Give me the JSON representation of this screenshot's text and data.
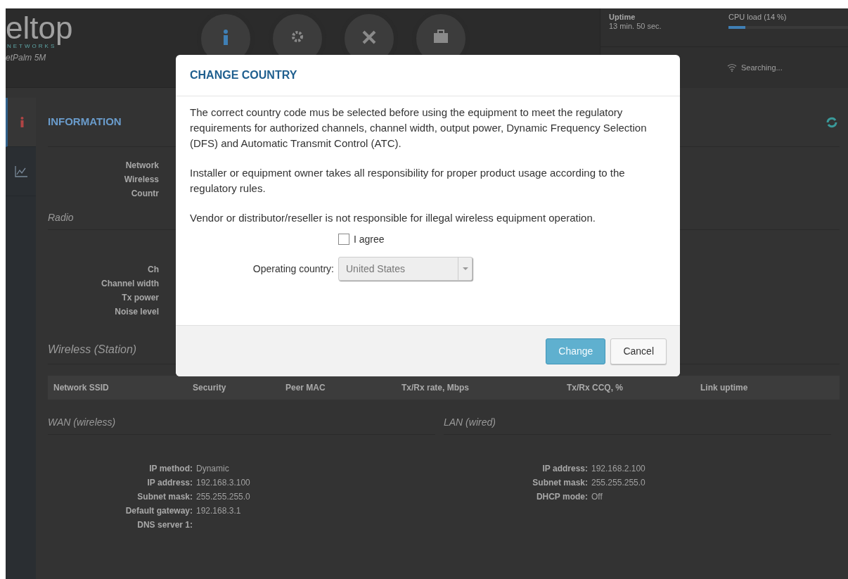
{
  "logo": {
    "name": "eltop",
    "tagline": "NETWORKS",
    "model": "etPalm 5M"
  },
  "status": {
    "uptime_label": "Uptime",
    "uptime_value": "13 min. 50 sec.",
    "cpu_label": "CPU load (14 %)",
    "cpu": {
      "level": 0.14
    },
    "wireless": "Searching..."
  },
  "sidebar": {
    "tabs": [
      {
        "kind": "info",
        "selected": true
      },
      {
        "kind": "chart",
        "selected": false
      }
    ]
  },
  "main": {
    "title": "INFORMATION",
    "info_labels": [
      "Network",
      "Wireless",
      "Countr"
    ],
    "radio": {
      "title": "Radio",
      "labels": [
        "Ch",
        "Channel width",
        "Tx power",
        "Noise level"
      ]
    },
    "wireless": {
      "title": "Wireless (Station)",
      "columns": [
        "Network SSID",
        "Security",
        "Peer MAC",
        "Tx/Rx rate, Mbps",
        "Tx/Rx CCQ, %",
        "Link uptime"
      ]
    },
    "wan": {
      "title": "WAN (wireless)",
      "rows": [
        {
          "label": "IP method:",
          "value": "Dynamic"
        },
        {
          "label": "IP address:",
          "value": "192.168.3.100"
        },
        {
          "label": "Subnet mask:",
          "value": "255.255.255.0"
        },
        {
          "label": "Default gateway:",
          "value": "192.168.3.1"
        },
        {
          "label": "DNS server 1:"
        }
      ]
    },
    "lan": {
      "title": "LAN (wired)",
      "rows": [
        {
          "label": "IP address:",
          "value": "192.168.2.100"
        },
        {
          "label": "Subnet mask:",
          "value": "255.255.255.0"
        },
        {
          "label": "DHCP mode:",
          "value": "Off"
        }
      ]
    }
  },
  "modal": {
    "title": "CHANGE COUNTRY",
    "paragraphs": [
      "The correct country code mus be selected before using the equipment to meet the regulatory requirements for authorized channels, channel width, output power, Dynamic Frequency Selection (DFS) and Automatic Transmit Control (ATC).",
      "Installer or equipment owner takes all responsibility for proper product usage according to the regulatory rules.",
      "Vendor or distributor/reseller is not responsible for illegal wireless equipment operation."
    ],
    "agree": {
      "label": "I agree",
      "checked": false
    },
    "country": {
      "label": "Operating country:",
      "value": "United States",
      "disabled": true
    },
    "buttons": [
      {
        "label": "Change",
        "kind": "primary",
        "disabled": true
      },
      {
        "label": "Cancel",
        "kind": "default",
        "disabled": false
      }
    ]
  }
}
